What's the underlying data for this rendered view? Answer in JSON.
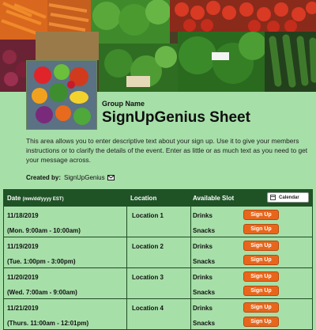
{
  "header": {
    "group_name": "Group Name",
    "title": "SignUpGenius Sheet",
    "description": "This area allows you to enter descriptive text about your sign up. Use it to give your members instructions or to clarify the details of the event. Enter as little or as much text as you need to get your message across.",
    "created_by_label": "Created by:",
    "created_by_name": "SignUpGenius"
  },
  "table": {
    "col_date": "Date",
    "col_date_fmt": "(mm/dd/yyyy EST)",
    "col_location": "Location",
    "col_slot": "Available Slot",
    "calendar_label": "Calendar",
    "signup_label": "Sign Up",
    "rows": [
      {
        "date": "11/18/2019",
        "time": "(Mon. 9:00am - 10:00am)",
        "location": "Location 1",
        "slots": [
          "Drinks",
          "Snacks"
        ]
      },
      {
        "date": "11/19/2019",
        "time": "(Tue. 1:00pm - 3:00pm)",
        "location": "Location 2",
        "slots": [
          "Drinks",
          "Snacks"
        ]
      },
      {
        "date": "11/20/2019",
        "time": "(Wed. 7:00am - 9:00am)",
        "location": "Location 3",
        "slots": [
          "Drinks",
          "Snacks"
        ]
      },
      {
        "date": "11/21/2019",
        "time": "(Thurs. 11:00am - 12:01pm)",
        "location": "Location 4",
        "slots": [
          "Drinks",
          "Snacks"
        ]
      }
    ]
  },
  "colors": {
    "page_bg": "#a7dfa9",
    "table_header_bg": "#1f5326",
    "signup_button": "#e8661c"
  },
  "icons": {
    "mail": "envelope-icon",
    "calendar": "calendar-icon"
  }
}
